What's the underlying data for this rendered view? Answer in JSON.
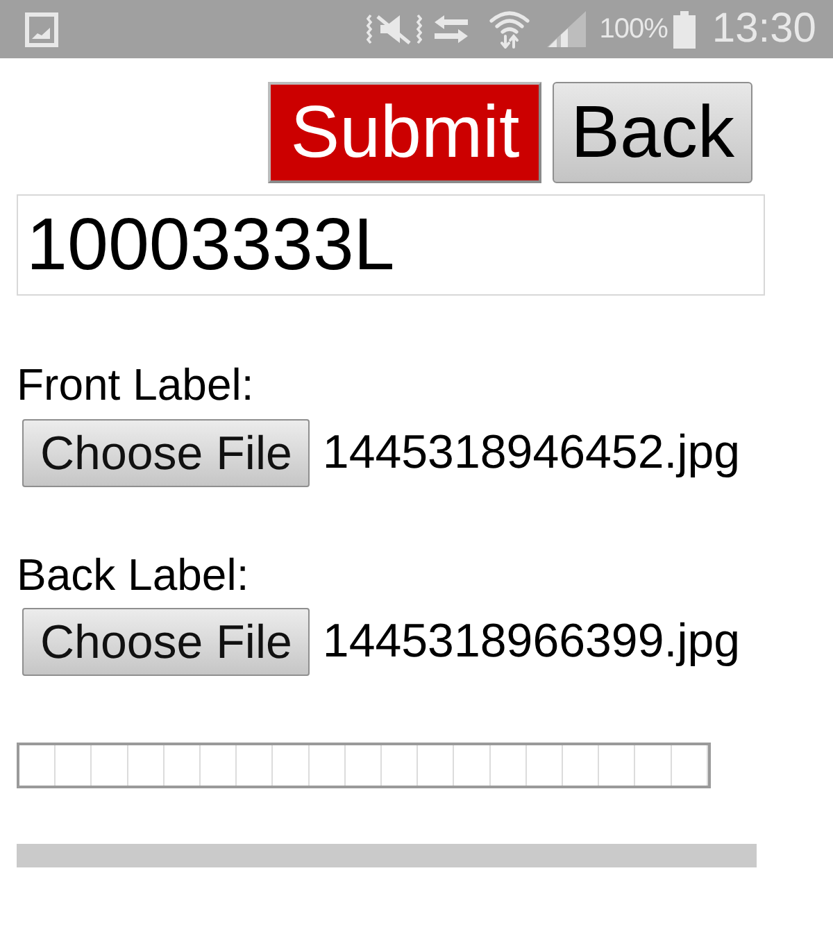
{
  "status_bar": {
    "battery": "100%",
    "time": "13:30"
  },
  "buttons": [
    {
      "label": "Submit",
      "kind": "primary"
    },
    {
      "label": "Back",
      "kind": "default"
    }
  ],
  "id_field": {
    "value": "10003333L"
  },
  "file_inputs": [
    {
      "label": "Front Label:",
      "button": "Choose File",
      "file_name": "1445318946452.jpg"
    },
    {
      "label": "Back Label:",
      "button": "Choose File",
      "file_name": "1445318966399.jpg"
    }
  ],
  "progress_bars": [
    {
      "kind": "segmented",
      "level": 0
    },
    {
      "kind": "flat",
      "level": 0
    }
  ]
}
